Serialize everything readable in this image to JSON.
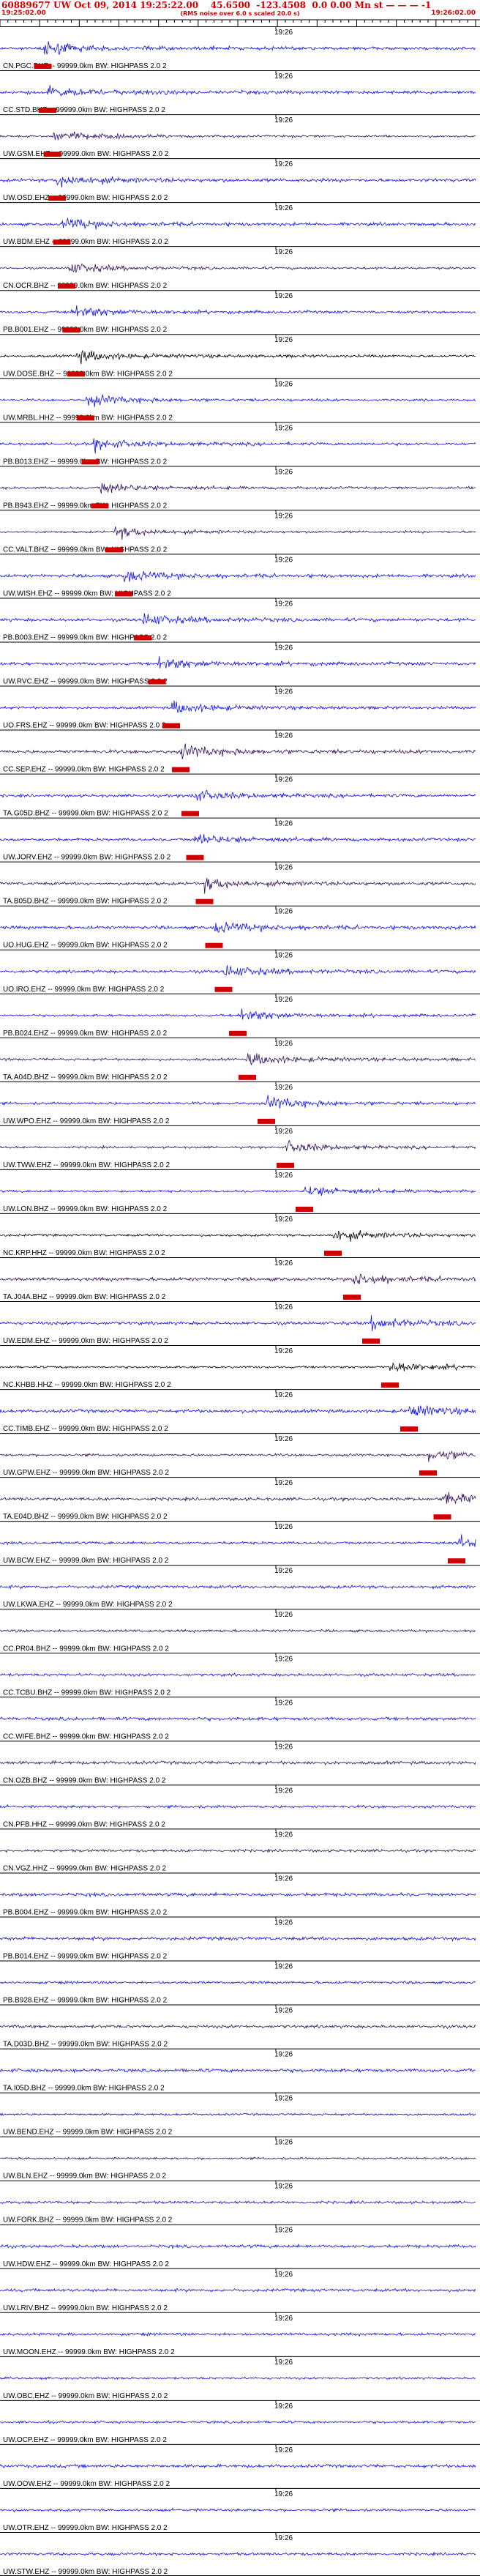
{
  "header": {
    "title": "60889677 UW Oct 09, 2014 19:25:22.00    45.6500  -123.4508  0.0 0.00 Mn st — — — -1",
    "start_time": "19:25:02.00",
    "end_time": "19:26:02.00",
    "note": "(RMS noise over 6.0 s scaled 20.0 s)"
  },
  "colors": {
    "pick": "#d00000",
    "text": "#d00000",
    "trace_blue": "#1010f0",
    "trace_purple": "#301060",
    "trace_black": "#000000"
  },
  "chart_data": {
    "type": "line",
    "tick_label": "19:26",
    "channels": [
      {
        "label": "CN.PGC.BHZ -- 99999.0km BW: HIGHPASS  2.0  2",
        "pick_frac": 0.09,
        "color": "blue"
      },
      {
        "label": "CC.STD.BHZ -- 99999.0km BW: HIGHPASS  2.0  2",
        "pick_frac": 0.1,
        "color": "blue"
      },
      {
        "label": "UW.GSM.EHZ -- 99999.0km BW: HIGHPASS  2.0  2",
        "pick_frac": 0.11,
        "color": "purple"
      },
      {
        "label": "UW.OSD.EHZ -- 99999.0km BW: HIGHPASS  2.0  2",
        "pick_frac": 0.12,
        "color": "blue"
      },
      {
        "label": "UW.BDM.EHZ -- 99999.0km BW: HIGHPASS  2.0  2",
        "pick_frac": 0.13,
        "color": "blue"
      },
      {
        "label": "CN.OCR.BHZ -- 99999.0km BW: HIGHPASS  2.0  2",
        "pick_frac": 0.14,
        "color": "purple"
      },
      {
        "label": "PB.B001.EHZ -- 99999.0km BW: HIGHPASS  2.0  2",
        "pick_frac": 0.15,
        "color": "blue"
      },
      {
        "label": "UW.DOSE.BHZ -- 99999.0km BW: HIGHPASS  2.0  2",
        "pick_frac": 0.16,
        "color": "black"
      },
      {
        "label": "UW.MRBL.HHZ -- 99999.0km BW: HIGHPASS  2.0  2",
        "pick_frac": 0.18,
        "color": "blue"
      },
      {
        "label": "PB.B013.EHZ -- 99999.0km BW: HIGHPASS  2.0  2",
        "pick_frac": 0.19,
        "color": "blue"
      },
      {
        "label": "PB.B943.EHZ -- 99999.0km BW: HIGHPASS  2.0  2",
        "pick_frac": 0.21,
        "color": "purple"
      },
      {
        "label": "CC.VALT.BHZ -- 99999.0km BW: HIGHPASS  2.0  2",
        "pick_frac": 0.24,
        "color": "purple"
      },
      {
        "label": "UW.WISH.EHZ -- 99999.0km BW: HIGHPASS  2.0  2",
        "pick_frac": 0.26,
        "color": "blue"
      },
      {
        "label": "PB.B003.EHZ -- 99999.0km BW: HIGHPASS  2.0  2",
        "pick_frac": 0.3,
        "color": "blue"
      },
      {
        "label": "UW.RVC.EHZ -- 99999.0km BW: HIGHPASS  2.0  2",
        "pick_frac": 0.33,
        "color": "blue"
      },
      {
        "label": "UO.FRS.EHZ -- 99999.0km BW: HIGHPASS  2.0  2",
        "pick_frac": 0.36,
        "color": "blue"
      },
      {
        "label": "CC.SEP.EHZ -- 99999.0km BW: HIGHPASS  2.0  2",
        "pick_frac": 0.38,
        "color": "purple"
      },
      {
        "label": "TA.G05D.BHZ -- 99999.0km BW: HIGHPASS  2.0  2",
        "pick_frac": 0.4,
        "color": "blue"
      },
      {
        "label": "UW.JORV.EHZ -- 99999.0km BW: HIGHPASS  2.0  2",
        "pick_frac": 0.41,
        "color": "blue"
      },
      {
        "label": "TA.B05D.BHZ -- 99999.0km BW: HIGHPASS  2.0  2",
        "pick_frac": 0.43,
        "color": "purple"
      },
      {
        "label": "UO.HUG.EHZ -- 99999.0km BW: HIGHPASS  2.0  2",
        "pick_frac": 0.45,
        "color": "blue"
      },
      {
        "label": "UO.IRO.EHZ -- 99999.0km BW: HIGHPASS  2.0  2",
        "pick_frac": 0.47,
        "color": "blue"
      },
      {
        "label": "PB.B024.EHZ -- 99999.0km BW: HIGHPASS  2.0  2",
        "pick_frac": 0.5,
        "color": "blue"
      },
      {
        "label": "TA.A04D.BHZ -- 99999.0km BW: HIGHPASS  2.0  2",
        "pick_frac": 0.52,
        "color": "purple"
      },
      {
        "label": "UW.WPO.EHZ -- 99999.0km BW: HIGHPASS  2.0  2",
        "pick_frac": 0.56,
        "color": "blue"
      },
      {
        "label": "UW.TWW.EHZ -- 99999.0km BW: HIGHPASS  2.0  2",
        "pick_frac": 0.6,
        "color": "purple"
      },
      {
        "label": "UW.LON.BHZ -- 99999.0km BW: HIGHPASS  2.0  2",
        "pick_frac": 0.64,
        "color": "blue"
      },
      {
        "label": "NC.KRP.HHZ -- 99999.0km BW: HIGHPASS  2.0  2",
        "pick_frac": 0.7,
        "color": "black"
      },
      {
        "label": "TA.J04A.BHZ -- 99999.0km BW: HIGHPASS  2.0  2",
        "pick_frac": 0.74,
        "color": "purple"
      },
      {
        "label": "UW.EDM.EHZ -- 99999.0km BW: HIGHPASS  2.0  2",
        "pick_frac": 0.78,
        "color": "blue"
      },
      {
        "label": "NC.KHBB.HHZ -- 99999.0km BW: HIGHPASS  2.0  2",
        "pick_frac": 0.82,
        "color": "black"
      },
      {
        "label": "CC.TIMB.EHZ -- 99999.0km BW: HIGHPASS  2.0  2",
        "pick_frac": 0.86,
        "color": "blue"
      },
      {
        "label": "UW.GPW.EHZ -- 99999.0km BW: HIGHPASS  2.0  2",
        "pick_frac": 0.9,
        "color": "purple"
      },
      {
        "label": "TA.E04D.BHZ -- 99999.0km BW: HIGHPASS  2.0  2",
        "pick_frac": 0.93,
        "color": "purple"
      },
      {
        "label": "UW.BCW.EHZ -- 99999.0km BW: HIGHPASS  2.0  2",
        "pick_frac": 0.96,
        "color": "blue"
      },
      {
        "label": "UW.LKWA.EHZ -- 99999.0km BW: HIGHPASS  2.0  2",
        "pick_frac": null,
        "color": "blue"
      },
      {
        "label": "CC.PR04.BHZ -- 99999.0km BW: HIGHPASS  2.0  2",
        "pick_frac": null,
        "color": "purple"
      },
      {
        "label": "CC.TCBU.BHZ -- 99999.0km BW: HIGHPASS  2.0  2",
        "pick_frac": null,
        "color": "blue"
      },
      {
        "label": "CC.WIFE.BHZ -- 99999.0km BW: HIGHPASS  2.0  2",
        "pick_frac": null,
        "color": "blue"
      },
      {
        "label": "CN.OZB.BHZ -- 99999.0km BW: HIGHPASS  2.0  2",
        "pick_frac": null,
        "color": "purple"
      },
      {
        "label": "CN.PFB.HHZ -- 99999.0km BW: HIGHPASS  2.0  2",
        "pick_frac": null,
        "color": "blue"
      },
      {
        "label": "CN.VGZ.HHZ -- 99999.0km BW: HIGHPASS  2.0  2",
        "pick_frac": null,
        "color": "purple"
      },
      {
        "label": "PB.B004.EHZ -- 99999.0km BW: HIGHPASS  2.0  2",
        "pick_frac": null,
        "color": "blue"
      },
      {
        "label": "PB.B014.EHZ -- 99999.0km BW: HIGHPASS  2.0  2",
        "pick_frac": null,
        "color": "blue"
      },
      {
        "label": "PB.B928.EHZ -- 99999.0km BW: HIGHPASS  2.0  2",
        "pick_frac": null,
        "color": "blue"
      },
      {
        "label": "TA.D03D.BHZ -- 99999.0km BW: HIGHPASS  2.0  2",
        "pick_frac": null,
        "color": "purple"
      },
      {
        "label": "TA.I05D.BHZ -- 99999.0km BW: HIGHPASS  2.0  2",
        "pick_frac": null,
        "color": "blue"
      },
      {
        "label": "UW.BEND.EHZ -- 99999.0km BW: HIGHPASS  2.0  2",
        "pick_frac": null,
        "color": "blue"
      },
      {
        "label": "UW.BLN.EHZ -- 99999.0km BW: HIGHPASS  2.0  2",
        "pick_frac": null,
        "color": "purple"
      },
      {
        "label": "UW.FORK.BHZ -- 99999.0km BW: HIGHPASS  2.0  2",
        "pick_frac": null,
        "color": "blue"
      },
      {
        "label": "UW.HDW.EHZ -- 99999.0km BW: HIGHPASS  2.0  2",
        "pick_frac": null,
        "color": "blue"
      },
      {
        "label": "UW.LRIV.BHZ -- 99999.0km BW: HIGHPASS  2.0  2",
        "pick_frac": null,
        "color": "blue"
      },
      {
        "label": "UW.MOON.EHZ -- 99999.0km BW: HIGHPASS  2.0  2",
        "pick_frac": null,
        "color": "blue"
      },
      {
        "label": "UW.OBC.EHZ -- 99999.0km BW: HIGHPASS  2.0  2",
        "pick_frac": null,
        "color": "blue"
      },
      {
        "label": "UW.OCP.EHZ -- 99999.0km BW: HIGHPASS  2.0  2",
        "pick_frac": null,
        "color": "blue"
      },
      {
        "label": "UW.OOW.EHZ -- 99999.0km BW: HIGHPASS  2.0  2",
        "pick_frac": null,
        "color": "blue"
      },
      {
        "label": "UW.OTR.EHZ -- 99999.0km BW: HIGHPASS  2.0  2",
        "pick_frac": null,
        "color": "blue"
      },
      {
        "label": "UW.STW.EHZ -- 99999.0km BW: HIGHPASS  2.0  2",
        "pick_frac": null,
        "color": "blue"
      }
    ]
  }
}
